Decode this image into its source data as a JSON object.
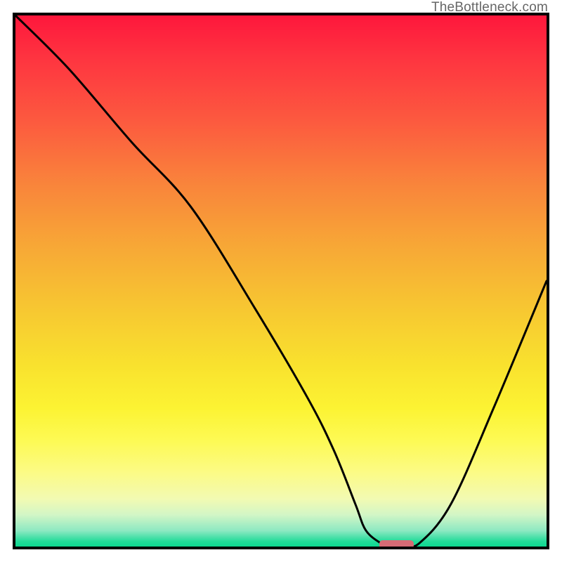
{
  "watermark": "TheBottleneck.com",
  "chart_data": {
    "type": "line",
    "title": "",
    "xlabel": "",
    "ylabel": "",
    "xlim": [
      0,
      100
    ],
    "ylim": [
      0,
      100
    ],
    "series": [
      {
        "name": "curve",
        "x": [
          0,
          10,
          22,
          33,
          45,
          55,
          60,
          64,
          66,
          69,
          70,
          73,
          76,
          82,
          90,
          100
        ],
        "y": [
          100,
          90,
          76,
          64,
          45,
          28,
          18,
          8,
          3,
          0.5,
          0.3,
          0.3,
          0.6,
          8,
          26,
          50
        ]
      }
    ],
    "marker": {
      "x_range": [
        68.5,
        75.0
      ],
      "y": 0.4,
      "color": "#d66b75"
    },
    "background_gradient": {
      "top": "#fe173c",
      "mid": "#f9e22e",
      "bottom": "#0cd890"
    }
  }
}
